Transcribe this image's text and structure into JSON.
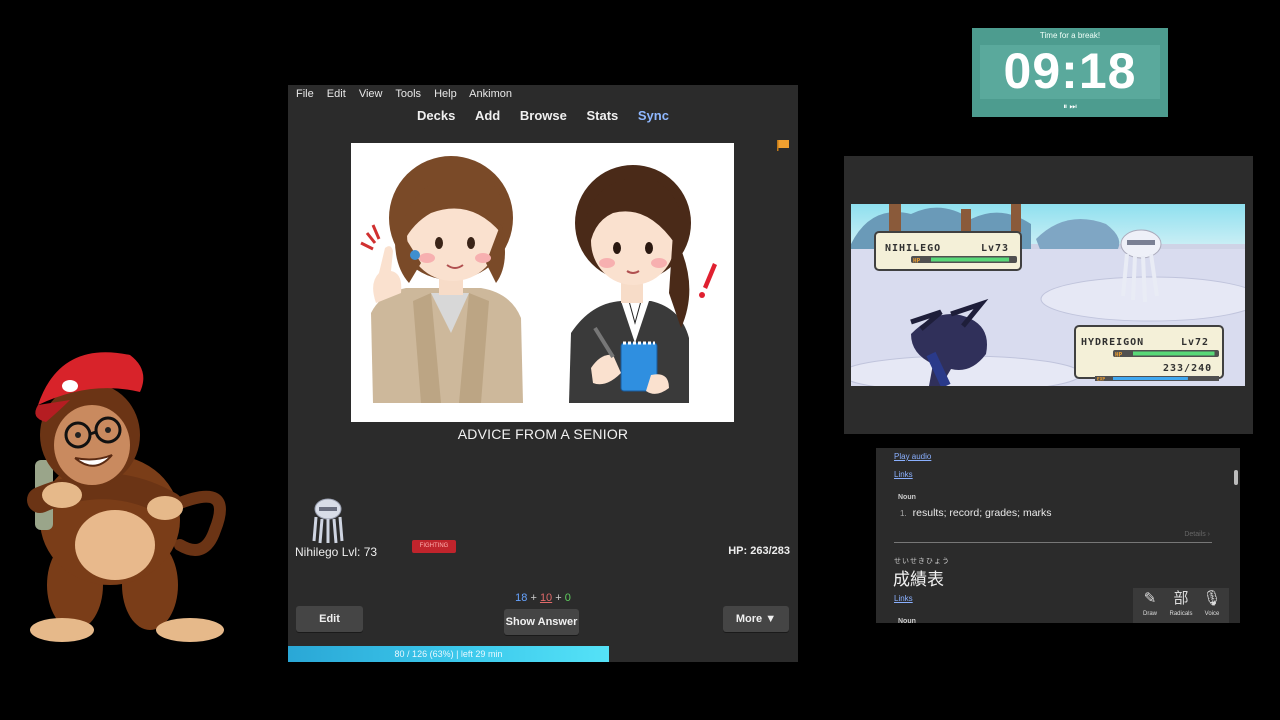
{
  "timer": {
    "title": "Time for a break!",
    "time": "09:18",
    "controls": "⏸ ⏭"
  },
  "anki": {
    "menu": [
      "File",
      "Edit",
      "View",
      "Tools",
      "Help",
      "Ankimon"
    ],
    "toolbar": [
      "Decks",
      "Add",
      "Browse",
      "Stats",
      "Sync"
    ],
    "card_word": "ADVICE FROM A SENIOR",
    "pokemon_label": "Nihilego Lvl: 73",
    "type_badge": "FIGHTING",
    "hp_label": "HP: 263/283",
    "counts": {
      "new": "18",
      "learn": "10",
      "review": "0",
      "plus": "+"
    },
    "buttons": {
      "edit": "Edit",
      "show_answer": "Show Answer",
      "more": "More ▼"
    },
    "progress_text": "80 / 126 (63%) | left 29 min",
    "progress_fraction": 0.63,
    "colors": {
      "new": "#66a3ff",
      "learn": "#e06a6a",
      "review": "#5fcf5f",
      "sync": "#8fb8ff"
    }
  },
  "battle": {
    "enemy": {
      "name": "NIHILEGO",
      "level": "Lv73",
      "hp_fraction": 0.93
    },
    "player": {
      "name": "HYDREIGON",
      "level": "Lv72",
      "hp_text": "233/240",
      "hp_fraction": 0.97,
      "exp_fraction": 0.72
    },
    "hp_tag": "HP",
    "exp_tag": "EXP"
  },
  "dictionary": {
    "play_audio": "Play audio",
    "links": "Links",
    "noun": "Noun",
    "definition_number": "1.",
    "definition": "results; record; grades; marks",
    "details": "Details ›",
    "furigana": "せいせきひょう",
    "kanji": "成績表",
    "tools": [
      {
        "icon": "✎",
        "label": "Draw"
      },
      {
        "icon": "部",
        "label": "Radicals"
      },
      {
        "icon": "🎙",
        "label": "Voice"
      }
    ]
  }
}
